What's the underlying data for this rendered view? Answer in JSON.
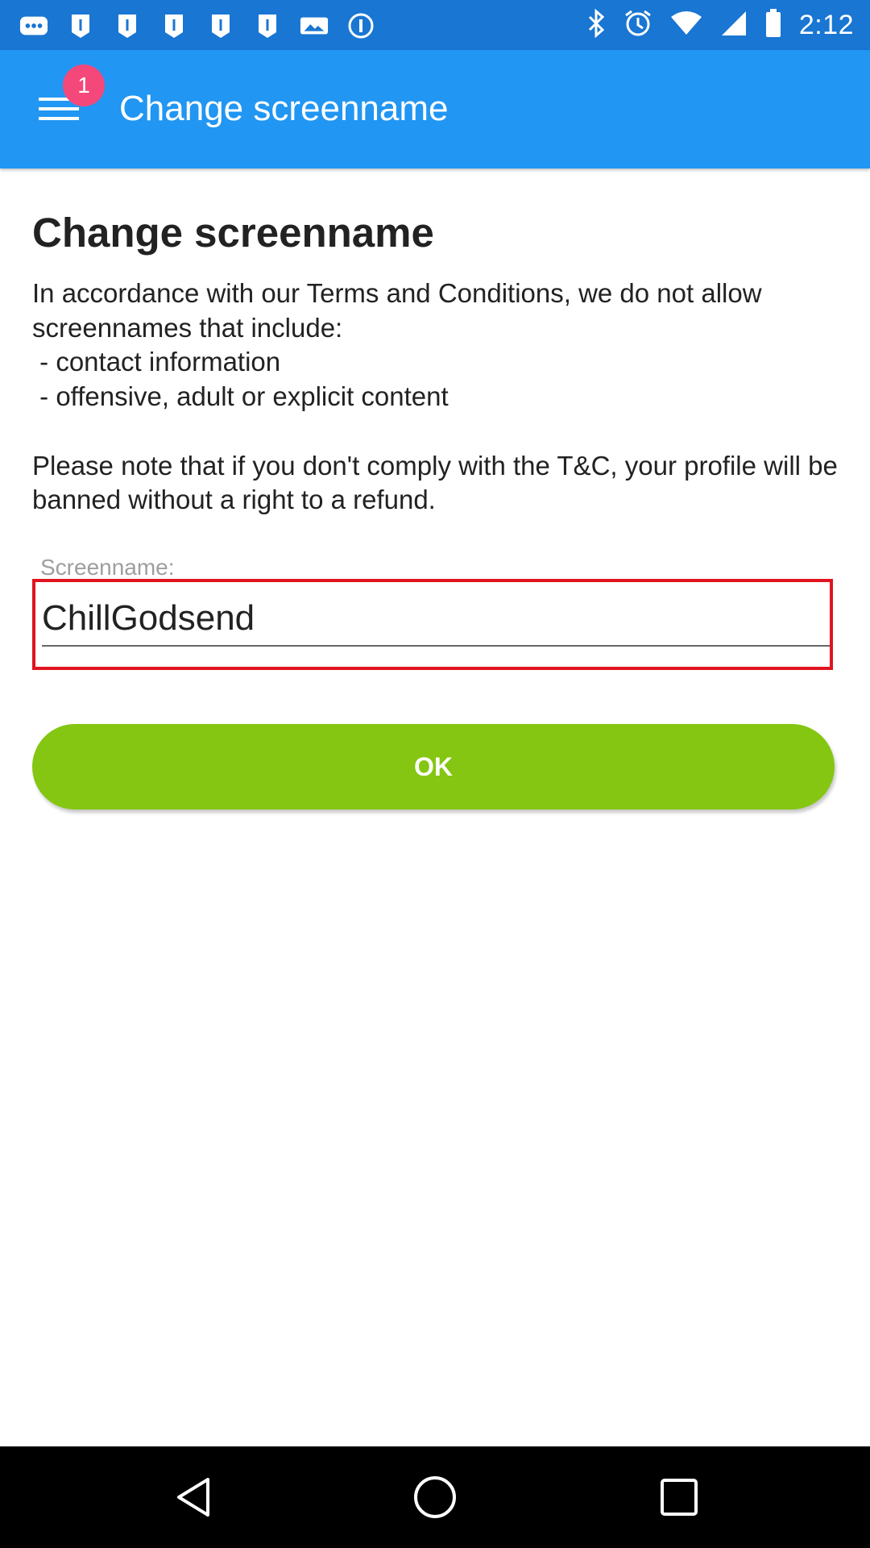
{
  "status_bar": {
    "time": "2:12",
    "left_icons": [
      "more-dots-icon",
      "notification-icon",
      "notification-icon",
      "notification-icon",
      "notification-icon",
      "notification-icon",
      "image-icon",
      "info-circle-icon"
    ],
    "right_icons": [
      "bluetooth-icon",
      "alarm-icon",
      "wifi-icon",
      "signal-icon",
      "battery-icon"
    ]
  },
  "app_bar": {
    "title": "Change screenname",
    "menu_badge": "1",
    "menu_icon": "hamburger-menu-icon"
  },
  "main": {
    "heading": "Change screenname",
    "info_text": "In accordance with our Terms and Conditions, we do not allow screennames that include:\n - contact information\n - offensive, adult or explicit content\n\nPlease note that if you don't comply with the T&C, your profile will be banned without a right to a refund.",
    "field_label": "Screenname:",
    "screenname_value": "ChillGodsend",
    "ok_label": "OK"
  },
  "nav_bar": {
    "icons": [
      "back-icon",
      "home-icon",
      "recents-icon"
    ]
  },
  "colors": {
    "status_bar": "#1976d2",
    "app_bar": "#2196f3",
    "badge": "#f5487a",
    "highlight_border": "#e0141e",
    "ok_button": "#84c611",
    "nav_bar": "#000000"
  }
}
